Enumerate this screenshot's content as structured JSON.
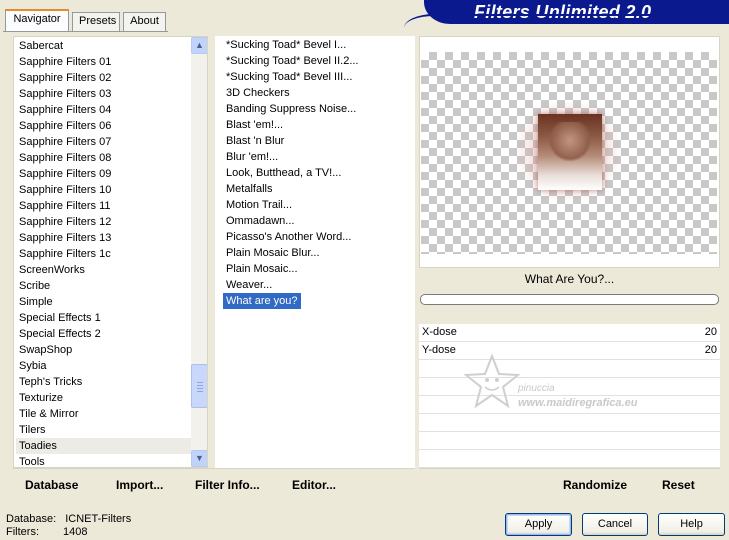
{
  "tabs": [
    "Navigator",
    "Presets",
    "About"
  ],
  "app_title": "Filters Unlimited 2.0",
  "categories": [
    "Sabercat",
    "Sapphire Filters 01",
    "Sapphire Filters 02",
    "Sapphire Filters 03",
    "Sapphire Filters 04",
    "Sapphire Filters 06",
    "Sapphire Filters 07",
    "Sapphire Filters 08",
    "Sapphire Filters 09",
    "Sapphire Filters 10",
    "Sapphire Filters 11",
    "Sapphire Filters 12",
    "Sapphire Filters 13",
    "Sapphire Filters 1c",
    "ScreenWorks",
    "Scribe",
    "Simple",
    "Special Effects 1",
    "Special Effects 2",
    "SwapShop",
    "Sybia",
    "Teph's Tricks",
    "Texturize",
    "Tile & Mirror",
    "Tilers",
    "Toadies",
    "Tools"
  ],
  "selected_category": "Toadies",
  "filters": [
    "*Sucking Toad*  Bevel I...",
    "*Sucking Toad*  Bevel II.2...",
    "*Sucking Toad*  Bevel III...",
    "3D Checkers",
    "Banding Suppress Noise...",
    "Blast 'em!...",
    "Blast 'n Blur",
    "Blur 'em!...",
    "Look, Butthead, a TV!...",
    "Metalfalls",
    "Motion Trail...",
    "Ommadawn...",
    "Picasso's Another Word...",
    "Plain Mosaic Blur...",
    "Plain Mosaic...",
    "Weaver...",
    "What are you?"
  ],
  "selected_filter": "What are you?",
  "filter_name_display": "What Are You?...",
  "params": [
    {
      "label": "X-dose",
      "value": "20"
    },
    {
      "label": "Y-dose",
      "value": "20"
    }
  ],
  "watermark": {
    "line1": "pinuccia",
    "line2": "www.maidiregrafica.eu"
  },
  "left_toolbar": {
    "database": "Database",
    "import": "Import...",
    "filter_info": "Filter Info...",
    "editor": "Editor..."
  },
  "right_toolbar": {
    "randomize": "Randomize",
    "reset": "Reset"
  },
  "status": {
    "database_label": "Database:",
    "database_value": "ICNET-Filters",
    "filters_label": "Filters:",
    "filters_value": "1408"
  },
  "buttons": {
    "apply": "Apply",
    "cancel": "Cancel",
    "help": "Help"
  },
  "colors": {
    "banner": "#0a1a8e",
    "selection": "#316ac5",
    "panel": "#ece9d8"
  }
}
